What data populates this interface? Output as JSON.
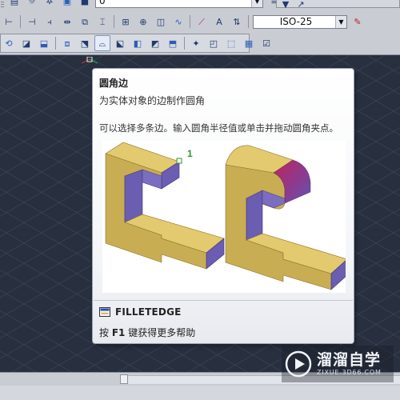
{
  "toolbar": {
    "dim_style_value": "ISO-25",
    "layer_value": "0"
  },
  "tooltip": {
    "title": "圆角边",
    "description": "为实体对象的边制作圆角",
    "detail": "可以选择多条边。输入圆角半径值或单击并拖动圆角夹点。",
    "callout": "1",
    "command_name": "FILLETEDGE",
    "help_key": "F1",
    "help_prefix": "按",
    "help_suffix": "键获得更多帮助"
  },
  "watermark": {
    "title": "溜溜自学",
    "subtitle": "ZIXUE.3D66.COM"
  },
  "colors": {
    "canvas_bg": "#283040",
    "solid_top": "#e2c86a",
    "solid_front": "#c9ad50",
    "solid_side": "#6b5fb0",
    "fillet_accent": "#c2235a"
  }
}
